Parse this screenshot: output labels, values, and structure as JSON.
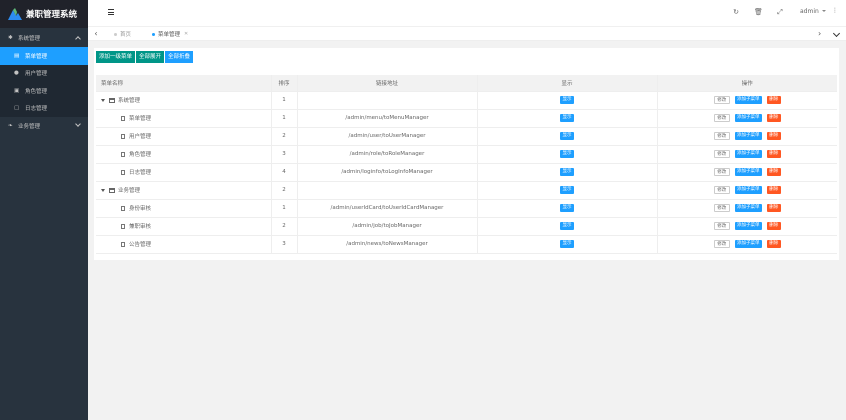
{
  "app": {
    "title": "兼职管理系统"
  },
  "colors": {
    "sidebar_bg": "#28333e",
    "active": "#1e9fff",
    "green": "#009688",
    "danger": "#ff5722"
  },
  "sidebar": {
    "groups": [
      {
        "label": "系统管理",
        "icon": "gear-icon",
        "expanded": true,
        "items": [
          {
            "label": "菜单管理",
            "icon": "calendar-icon",
            "active": true
          },
          {
            "label": "用户管理",
            "icon": "user-icon",
            "active": false
          },
          {
            "label": "角色管理",
            "icon": "id-card-icon",
            "active": false
          },
          {
            "label": "日志管理",
            "icon": "log-icon",
            "active": false
          }
        ]
      },
      {
        "label": "业务管理",
        "icon": "leaf-icon",
        "expanded": false,
        "items": []
      }
    ]
  },
  "header": {
    "user": "admin"
  },
  "tabs": [
    {
      "label": "首页",
      "active": false
    },
    {
      "label": "菜单管理",
      "active": true
    }
  ],
  "toolbar": {
    "add_top": "添加一级菜单",
    "expand_all": "全部展开",
    "collapse_all": "全部折叠"
  },
  "table": {
    "headers": {
      "name": "菜单名称",
      "order": "排序",
      "url": "链接地址",
      "show": "显示",
      "ops": "操作"
    },
    "show_label": "显示",
    "ops": {
      "edit": "修改",
      "add_child": "添加子菜单",
      "delete": "删除"
    },
    "rows": [
      {
        "name": "系统管理",
        "order": "1",
        "url": "",
        "level": 0
      },
      {
        "name": "菜单管理",
        "order": "1",
        "url": "/admin/menu/toMenuManager",
        "level": 1
      },
      {
        "name": "用户管理",
        "order": "2",
        "url": "/admin/user/toUserManager",
        "level": 1
      },
      {
        "name": "角色管理",
        "order": "3",
        "url": "/admin/role/toRoleManager",
        "level": 1
      },
      {
        "name": "日志管理",
        "order": "4",
        "url": "/admin/loginfo/toLogInfoManager",
        "level": 1
      },
      {
        "name": "业务管理",
        "order": "2",
        "url": "",
        "level": 0
      },
      {
        "name": "身份审核",
        "order": "1",
        "url": "/admin/userIdCard/toUserIdCardManager",
        "level": 1
      },
      {
        "name": "兼职审核",
        "order": "2",
        "url": "/admin/job/toJobManager",
        "level": 1
      },
      {
        "name": "公告管理",
        "order": "3",
        "url": "/admin/news/toNewsManager",
        "level": 1
      }
    ]
  }
}
